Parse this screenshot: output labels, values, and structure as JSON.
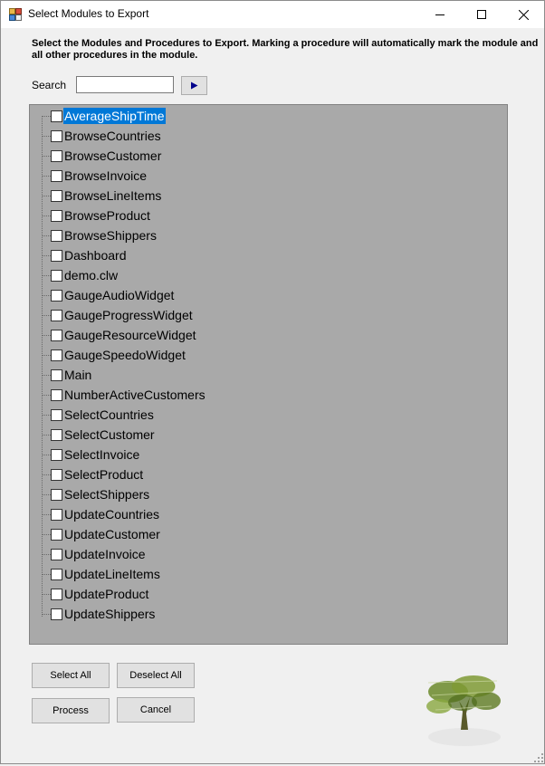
{
  "window": {
    "title": "Select Modules to Export",
    "minimize_label": "Minimize",
    "maximize_label": "Maximize",
    "close_label": "Close"
  },
  "instruction": "Select the Modules and Procedures to Export. Marking a procedure will automatically mark the module and all other procedures in the module.",
  "search": {
    "label": "Search",
    "value": ""
  },
  "tree": {
    "selected_index": 0,
    "items": [
      {
        "label": "AverageShipTime",
        "checked": false
      },
      {
        "label": "BrowseCountries",
        "checked": false
      },
      {
        "label": "BrowseCustomer",
        "checked": false
      },
      {
        "label": "BrowseInvoice",
        "checked": false
      },
      {
        "label": "BrowseLineItems",
        "checked": false
      },
      {
        "label": "BrowseProduct",
        "checked": false
      },
      {
        "label": "BrowseShippers",
        "checked": false
      },
      {
        "label": "Dashboard",
        "checked": false
      },
      {
        "label": "demo.clw",
        "checked": false
      },
      {
        "label": "GaugeAudioWidget",
        "checked": false
      },
      {
        "label": "GaugeProgressWidget",
        "checked": false
      },
      {
        "label": "GaugeResourceWidget",
        "checked": false
      },
      {
        "label": "GaugeSpeedoWidget",
        "checked": false
      },
      {
        "label": "Main",
        "checked": false
      },
      {
        "label": "NumberActiveCustomers",
        "checked": false
      },
      {
        "label": "SelectCountries",
        "checked": false
      },
      {
        "label": "SelectCustomer",
        "checked": false
      },
      {
        "label": "SelectInvoice",
        "checked": false
      },
      {
        "label": "SelectProduct",
        "checked": false
      },
      {
        "label": "SelectShippers",
        "checked": false
      },
      {
        "label": "UpdateCountries",
        "checked": false
      },
      {
        "label": "UpdateCustomer",
        "checked": false
      },
      {
        "label": "UpdateInvoice",
        "checked": false
      },
      {
        "label": "UpdateLineItems",
        "checked": false
      },
      {
        "label": "UpdateProduct",
        "checked": false
      },
      {
        "label": "UpdateShippers",
        "checked": false
      }
    ]
  },
  "buttons": {
    "select_all": "Select All",
    "deselect_all": "Deselect All",
    "process": "Process",
    "cancel": "Cancel"
  },
  "icons": {
    "app": "app-icon",
    "go": "play-arrow-icon",
    "logo": "tree-logo"
  },
  "colors": {
    "tree_background": "#a9a9a9",
    "selection": "#0078d7",
    "go_arrow": "#00008b"
  }
}
